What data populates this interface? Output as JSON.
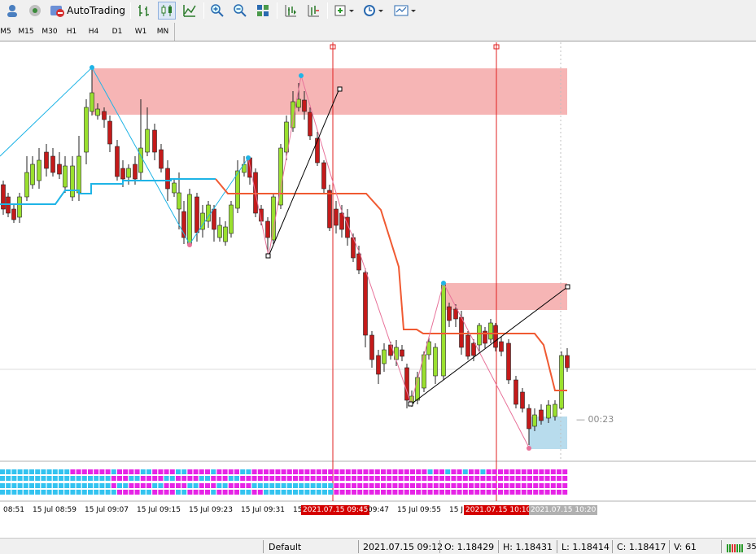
{
  "toolbar": {
    "autotrading_label": "AutoTrading"
  },
  "timeframes": [
    "M5",
    "M15",
    "M30",
    "H1",
    "H4",
    "D1",
    "W1",
    "MN"
  ],
  "chart": {
    "countdown": "00:23",
    "time_labels": [
      {
        "text": "08:51",
        "style": "normal"
      },
      {
        "text": "15 Jul 08:59",
        "style": "normal"
      },
      {
        "text": "15 Jul 09:07",
        "style": "normal"
      },
      {
        "text": "15 Jul 09:15",
        "style": "normal"
      },
      {
        "text": "15 Jul 09:23",
        "style": "normal"
      },
      {
        "text": "15 Jul 09:31",
        "style": "normal"
      },
      {
        "text": "15 J",
        "style": "normal"
      },
      {
        "text": "2021.07.15 09:45",
        "style": "highlight"
      },
      {
        "text": "09:47",
        "style": "normal"
      },
      {
        "text": "15 Jul 09:55",
        "style": "normal"
      },
      {
        "text": "15 J",
        "style": "normal"
      },
      {
        "text": "2021.07.15 10:10",
        "style": "highlight"
      },
      {
        "text": "2021.07.15 10:20",
        "style": "grey"
      }
    ],
    "colors": {
      "bull": "#9ae02e",
      "bear": "#c41a1a",
      "supply_zone": "#f4a8a8",
      "demand_zone": "#b8dced",
      "cyan_line": "#1fb4e6",
      "orange_line": "#f05a32",
      "pink_dot": "#e8739a",
      "vertical_line": "#e02020",
      "indicator_cyan": "#33c3f0",
      "indicator_magenta": "#e624e6"
    }
  },
  "status": {
    "profile": "Default",
    "datetime": "2021.07.15 09:12",
    "open": "O: 1.18429",
    "high": "H: 1.18431",
    "low": "L: 1.18414",
    "close": "C: 1.18417",
    "volume": "V: 61",
    "traffic": "35"
  }
}
